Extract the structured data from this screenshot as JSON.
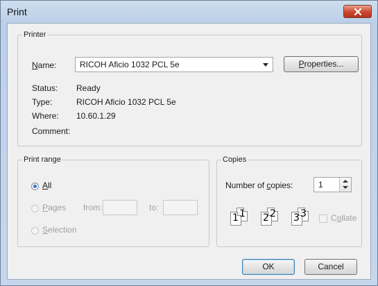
{
  "window": {
    "title": "Print"
  },
  "printer": {
    "group_label": "Printer",
    "name_label": "Name:",
    "name_value": "RICOH Aficio 1032 PCL 5e",
    "properties_label": "Properties...",
    "status_label": "Status:",
    "status_value": "Ready",
    "type_label": "Type:",
    "type_value": "RICOH Aficio 1032 PCL 5e",
    "where_label": "Where:",
    "where_value": "10.60.1.29",
    "comment_label": "Comment:"
  },
  "print_range": {
    "group_label": "Print range",
    "all_label": "All",
    "pages_label": "Pages",
    "from_label": "from:",
    "to_label": "to:",
    "selection_label": "Selection",
    "selected": "All"
  },
  "copies": {
    "group_label": "Copies",
    "number_label": "Number of copies:",
    "number_value": "1",
    "collate_label": "Collate",
    "collate_checked": false,
    "page_digits": [
      "1",
      "1",
      "2",
      "2",
      "3",
      "3"
    ]
  },
  "footer": {
    "ok_label": "OK",
    "cancel_label": "Cancel"
  },
  "icons": [
    "close-icon",
    "dropdown-arrow-icon",
    "spin-up-icon",
    "spin-down-icon",
    "collate-pages-icon"
  ]
}
